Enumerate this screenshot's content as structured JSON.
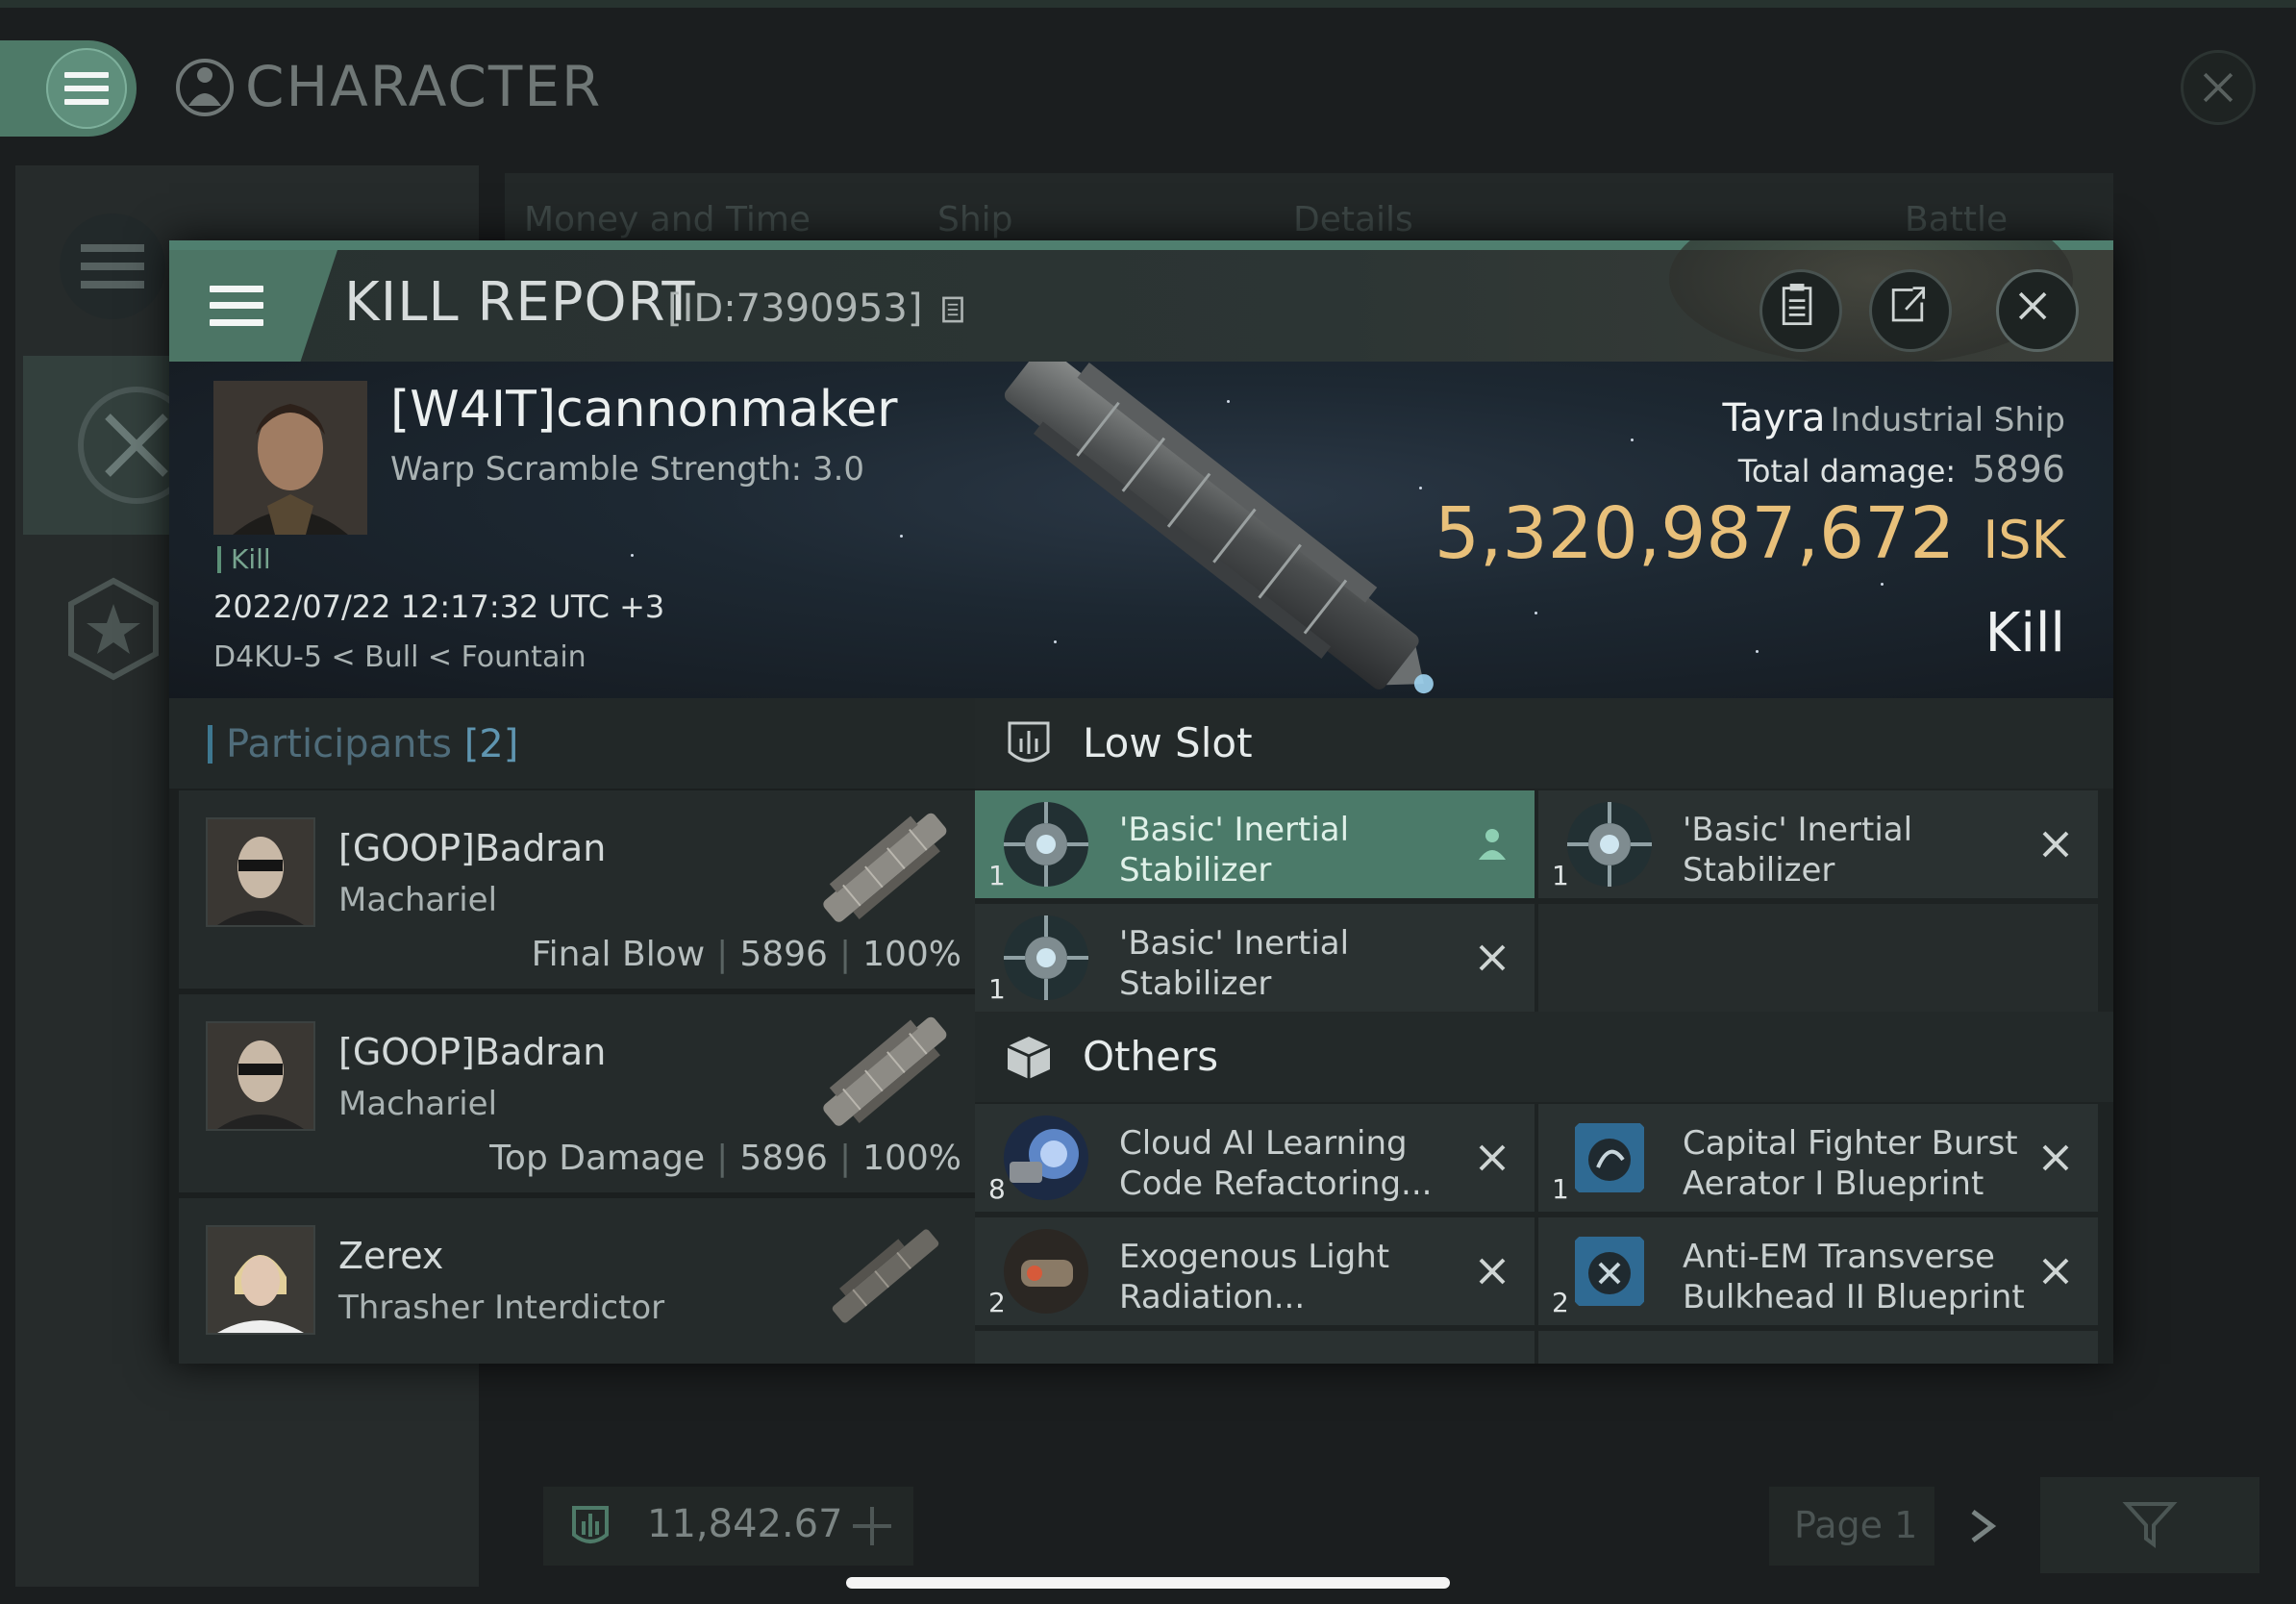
{
  "app": {
    "window_title": "CHARACTER",
    "tabs": [
      "Money and Time",
      "Ship",
      "Details",
      "Battle Status"
    ]
  },
  "footer": {
    "amount": "11,842.67",
    "page": "Page 1"
  },
  "kill_report": {
    "title": "KILL REPORT",
    "id": "[ID:7390953]",
    "victim": {
      "name": "[W4IT]cannonmaker",
      "warp_scramble": "Warp Scramble Strength: 3.0",
      "tag": "Kill",
      "time": "2022/07/22 12:17:32 UTC +3",
      "location": "D4KU-5 < Bull < Fountain"
    },
    "ship": {
      "name": "Tayra",
      "class": "Industrial Ship",
      "damage_label": "Total damage:",
      "damage_value": "5896",
      "isk_value": "5,320,987,672",
      "isk_unit": "ISK",
      "result": "Kill"
    },
    "participants": {
      "title": "Participants",
      "count": "[2]",
      "rows": [
        {
          "name": "[GOOP]Badran",
          "ship": "Machariel",
          "role": "Final Blow",
          "damage": "5896",
          "percent": "100%"
        },
        {
          "name": "[GOOP]Badran",
          "ship": "Machariel",
          "role": "Top Damage",
          "damage": "5896",
          "percent": "100%"
        },
        {
          "name": "Zerex",
          "ship": "Thrasher Interdictor",
          "role": "",
          "damage": "",
          "percent": ""
        }
      ]
    },
    "low_slot": {
      "title": "Low Slot",
      "items": [
        {
          "name": "'Basic' Inertial Stabilizer",
          "qty": "1",
          "selected": true
        },
        {
          "name": "'Basic' Inertial Stabilizer",
          "qty": "1",
          "selected": false
        },
        {
          "name": "'Basic' Inertial Stabilizer",
          "qty": "1",
          "selected": false
        }
      ]
    },
    "others": {
      "title": "Others",
      "items": [
        {
          "name": "Cloud AI Learning Code Refactoring...",
          "qty": "8"
        },
        {
          "name": "Capital Fighter Burst Aerator I Blueprint",
          "qty": "1"
        },
        {
          "name": "Exogenous Light Radiation...",
          "qty": "2"
        },
        {
          "name": "Anti-EM Transverse Bulkhead II Blueprint",
          "qty": "2"
        }
      ]
    }
  },
  "colors": {
    "accent": "#4b7a69",
    "isk": "#e8c07a",
    "participants_title": "#4f6c7a"
  },
  "icons": [
    "menu-icon",
    "character-icon",
    "close-icon",
    "clipboard-icon",
    "share-icon",
    "low-slot-icon",
    "others-cube-icon",
    "pilot-icon",
    "remove-icon",
    "plus-icon",
    "chevron-right-icon",
    "filter-icon",
    "star-icon",
    "swords-icon",
    "copy-icon"
  ]
}
